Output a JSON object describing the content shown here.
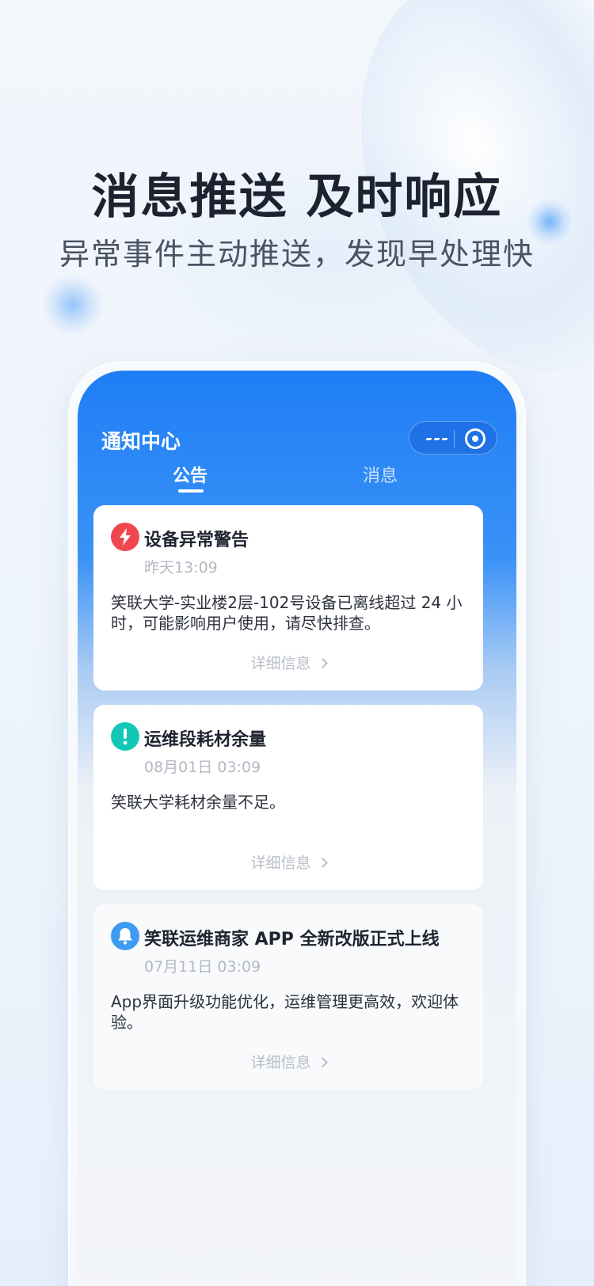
{
  "promo": {
    "headline": "消息推送 及时响应",
    "subheadline": "异常事件主动推送，发现早处理快"
  },
  "screen": {
    "title": "通知中心",
    "tabs": [
      {
        "label": "公告",
        "active": true
      },
      {
        "label": "消息",
        "active": false
      }
    ],
    "capsule": {
      "more_icon": "more-icon",
      "close_icon": "close-circle-icon"
    }
  },
  "cards": [
    {
      "icon": "lightning-icon",
      "icon_color": "#f0474f",
      "title": "设备异常警告",
      "time": "昨天13:09",
      "body": "笑联大学-实业楼2层-102号设备已离线超过 24 小时，可能影响用户使用，请尽快排查。",
      "detail_label": "详细信息"
    },
    {
      "icon": "exclamation-icon",
      "icon_color": "#12c7b6",
      "title": "运维段耗材余量",
      "time": "08月01日 03:09",
      "body": "笑联大学耗材余量不足。",
      "detail_label": "详细信息"
    },
    {
      "icon": "bell-icon",
      "icon_color": "#3f9af2",
      "title": "笑联运维商家 APP 全新改版正式上线",
      "time": "07月11日 03:09",
      "body": "App界面升级功能优化，运维管理更高效，欢迎体验。",
      "detail_label": "详细信息"
    }
  ]
}
